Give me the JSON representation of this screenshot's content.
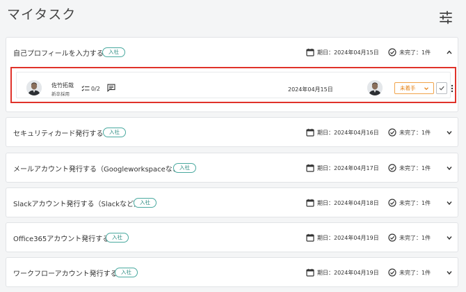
{
  "page": {
    "title": "マイタスク"
  },
  "tasks": [
    {
      "title": "自己プロフィールを入力する",
      "tag": "入社",
      "due": "期日：2024年04月15日",
      "status": "未完了：1件"
    },
    {
      "title": "セキュリティカード発行する",
      "tag": "入社",
      "due": "期日：2024年04月16日",
      "status": "未完了：1件"
    },
    {
      "title": "メールアカウント発行する（Googleworkspaceなど）",
      "tag": "入社",
      "due": "期日：2024年04月17日",
      "status": "未完了：1件"
    },
    {
      "title": "Slackアカウント発行する（Slackなど）",
      "tag": "入社",
      "due": "期日：2024年04月18日",
      "status": "未完了：1件"
    },
    {
      "title": "Office365アカウント発行する",
      "tag": "入社",
      "due": "期日：2024年04月19日",
      "status": "未完了：1件"
    },
    {
      "title": "ワークフローアカウント発行する",
      "tag": "入社",
      "due": "期日：2024年04月19日",
      "status": "未完了：1件"
    }
  ],
  "subtask": {
    "person_name": "佐竹拓哉",
    "person_role": "新卒採用",
    "checklist": "0/2",
    "date": "2024年04月15日",
    "status_value": "未着手"
  },
  "colors": {
    "highlight_border": "#e0322a",
    "tag_border": "#49a99f",
    "status_orange": "#e57f0f"
  },
  "icons": [
    "filter-sliders-icon",
    "calendar-icon",
    "check-circle-icon",
    "chevron-up-icon",
    "chevron-down-icon",
    "checklist-icon",
    "comment-icon",
    "checkmark-icon",
    "more-vertical-icon"
  ]
}
